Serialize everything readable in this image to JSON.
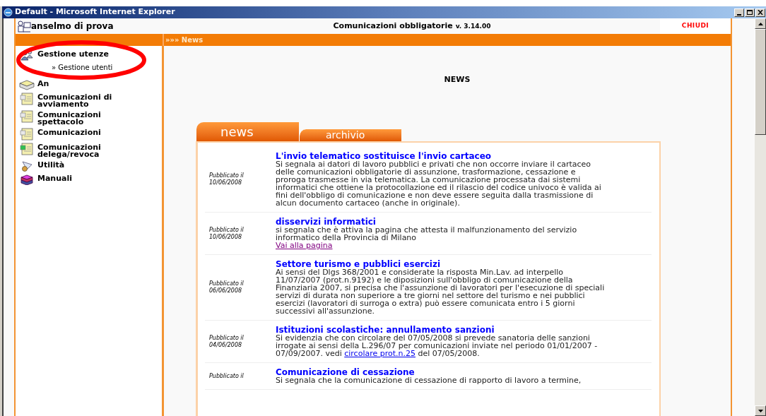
{
  "window": {
    "title": "Default - Microsoft Internet Explorer"
  },
  "header": {
    "user": "anselmo di prova",
    "app_title": "Comunicazioni obbligatorie",
    "version": "v. 3.14.00",
    "close_label": "CHIUDI"
  },
  "breadcrumb": "»»» News",
  "sidebar": {
    "items": [
      {
        "label": "Gestione utenze",
        "kind": "users",
        "children": [
          {
            "label": "» Gestione utenti"
          }
        ]
      },
      {
        "label": "An",
        "kind": "folder"
      },
      {
        "label": "Comunicazioni di avviamento",
        "kind": "doc"
      },
      {
        "label": "Comunicazioni spettacolo",
        "kind": "doc"
      },
      {
        "label": "Comunicazioni",
        "kind": "doc"
      },
      {
        "label": "Comunicazioni delega/revoca",
        "kind": "docgreen"
      },
      {
        "label": "Utilità",
        "kind": "tools"
      },
      {
        "label": "Manuali",
        "kind": "books"
      }
    ]
  },
  "page_title": "NEWS",
  "tabs": [
    {
      "label": "news",
      "selected": true
    },
    {
      "label": "archivio",
      "selected": false
    }
  ],
  "news": [
    {
      "date_label": "Pubblicato il",
      "date": "10/06/2008",
      "title": "L'invio telematico sostituisce l'invio cartaceo",
      "body": [
        {
          "kind": "text",
          "text": "Si segnala ai datori di lavoro pubblici e privati che non occorre inviare il cartaceo delle comunicazioni obbligatorie di assunzione, trasformazione, cessazione e proroga trasmesse in via telematica. La comunicazione processata dai sistemi informatici che ottiene la protocollazione ed il rilascio del codice univoco è valida ai fini dell'obbligo di comunicazione e non deve essere seguita dalla trasmissione di alcun documento cartaceo (anche in originale)."
        }
      ]
    },
    {
      "date_label": "Pubblicato il",
      "date": "10/06/2008",
      "title": "disservizi informatici",
      "body": [
        {
          "kind": "text",
          "text": "si segnala che è attiva la pagina che attesta il malfunzionamento del servizio informatico della Provincia di Milano"
        },
        {
          "kind": "linkline",
          "text": "Vai alla pagina",
          "visited": true
        }
      ]
    },
    {
      "date_label": "Pubblicato il",
      "date": "06/06/2008",
      "title": "Settore turismo e pubblici esercizi",
      "body": [
        {
          "kind": "text",
          "text": "Ai sensi del Dlgs 368/2001 e considerate la risposta Min.Lav. ad interpello 11/07/2007 (prot.n.9192) e le diposizioni sull'obbligo di comunicazione della Finanziaria 2007, si precisa che l'assunzione di lavoratori per l'esecuzione di speciali servizi di durata non superiore a tre giorni nel settore del turismo e nei pubblici esercizi (lavoratori di surroga o extra) può essere comunicata entro i 5 giorni successivi all'assunzione."
        }
      ]
    },
    {
      "date_label": "Pubblicato il",
      "date": "04/06/2008",
      "title": "Istituzioni scolastiche: annullamento sanzioni",
      "body": [
        {
          "kind": "text",
          "text": "Si evidenzia che con circolare del 07/05/2008 si prevede sanatoria delle sanzioni irrogate ai sensi della L.296/07 per comunicazioni inviate nel periodo 01/01/2007 - 07/09/2007. vedi "
        },
        {
          "kind": "link",
          "text": "circolare prot.n.25",
          "visited": false
        },
        {
          "kind": "text",
          "text": " del 07/05/2008."
        }
      ]
    },
    {
      "date_label": "Pubblicato il",
      "title": "Comunicazione di cessazione",
      "body": [
        {
          "kind": "text",
          "text": "Si segnala che la comunicazione di cessazione di rapporto di lavoro a termine,"
        }
      ]
    }
  ]
}
